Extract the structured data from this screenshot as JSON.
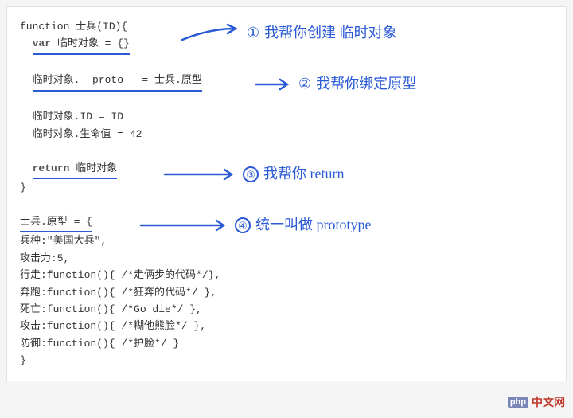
{
  "code": {
    "l1": "function 士兵(ID){",
    "l2_kw": "var",
    "l2_rest": " 临时对象 = {}",
    "l3": "临时对象.__proto__ = 士兵.原型",
    "l4": "临时对象.ID = ID",
    "l5": "临时对象.生命值 = 42",
    "l6_kw": "return",
    "l6_rest": "  临时对象",
    "l7": "}",
    "l8": "士兵.原型 = {",
    "l9": "  兵种:\"美国大兵\",",
    "l10": "  攻击力:5,",
    "l11": "  行走:function(){  /*走俩步的代码*/},",
    "l12": "  奔跑:function(){  /*狂奔的代码*/  },",
    "l13": "  死亡:function(){  /*Go die*/    },",
    "l14": "  攻击:function(){  /*糊他熊脸*/   },",
    "l15": "  防御:function(){  /*护脸*/     }",
    "l16": "}"
  },
  "annotations": {
    "a1_num": "①",
    "a1_text": "我帮你创建 临时对象",
    "a2_num": "②",
    "a2_text": "我帮你绑定原型",
    "a3_num": "③",
    "a3_text": "我帮你 return",
    "a4_num": "④",
    "a4_text": "统一叫做 prototype"
  },
  "watermark": {
    "php": "php",
    "cn": "中文网"
  }
}
